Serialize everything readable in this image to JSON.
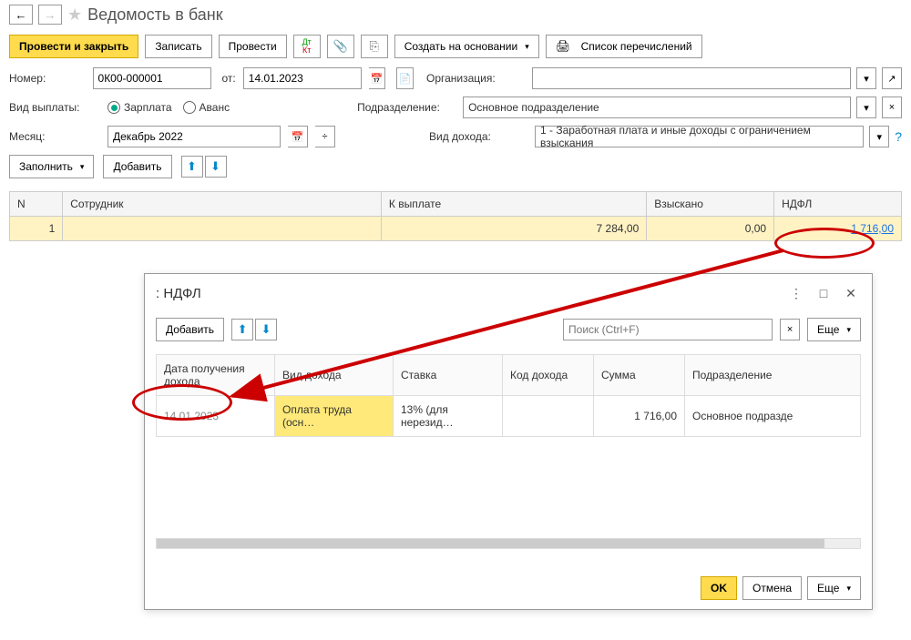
{
  "header": {
    "title": "Ведомость в банк"
  },
  "toolbar": {
    "post_close": "Провести и закрыть",
    "save": "Записать",
    "post": "Провести",
    "create_based": "Создать на основании",
    "transfer_list": "Список перечислений"
  },
  "form": {
    "number_label": "Номер:",
    "number_value": "0К00-000001",
    "date_label": "от:",
    "date_value": "14.01.2023",
    "payment_type_label": "Вид выплаты:",
    "payment_type_salary": "Зарплата",
    "payment_type_advance": "Аванс",
    "month_label": "Месяц:",
    "month_value": "Декабрь 2022",
    "org_label": "Организация:",
    "org_value": "",
    "dept_label": "Подразделение:",
    "dept_value": "Основное подразделение",
    "income_label": "Вид дохода:",
    "income_value": "1 - Заработная плата и иные доходы с ограничением взыскания",
    "fill": "Заполнить",
    "add": "Добавить"
  },
  "table": {
    "col_n": "N",
    "col_employee": "Сотрудник",
    "col_to_pay": "К выплате",
    "col_collected": "Взыскано",
    "col_ndfl": "НДФЛ",
    "rows": [
      {
        "n": "1",
        "employee": "",
        "to_pay": "7 284,00",
        "collected": "0,00",
        "ndfl": "1 716,00"
      }
    ]
  },
  "dialog": {
    "title_suffix": ": НДФЛ",
    "add": "Добавить",
    "search_placeholder": "Поиск (Ctrl+F)",
    "more": "Еще",
    "cols": {
      "date": "Дата получения дохода",
      "kind": "Вид дохода",
      "rate": "Ставка",
      "code": "Код дохода",
      "sum": "Сумма",
      "dept": "Подразделение"
    },
    "rows": [
      {
        "date": "14.01.2023",
        "kind": "Оплата труда (осн…",
        "rate": "13% (для нерезид…",
        "code": "",
        "sum": "1 716,00",
        "dept": "Основное подразде"
      }
    ],
    "ok": "OK",
    "cancel": "Отмена"
  }
}
